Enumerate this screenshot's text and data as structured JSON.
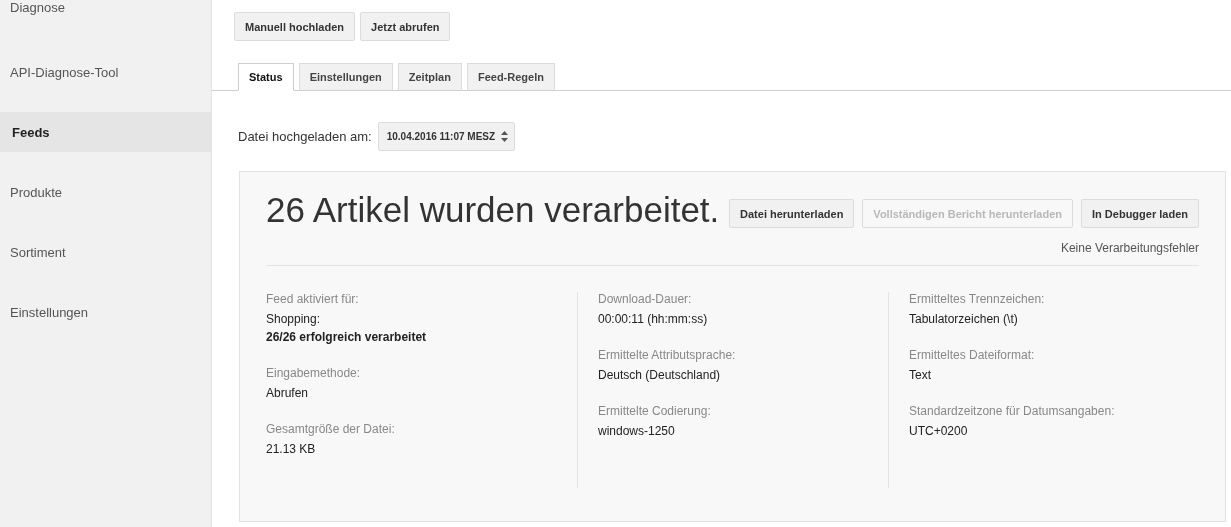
{
  "sidebar": {
    "items": [
      {
        "label": "Diagnose",
        "selected": false
      },
      {
        "label": "API-Diagnose-Tool",
        "selected": false
      },
      {
        "label": "Feeds",
        "selected": true
      },
      {
        "label": "Produkte",
        "selected": false
      },
      {
        "label": "Sortiment",
        "selected": false
      },
      {
        "label": "Einstellungen",
        "selected": false
      }
    ]
  },
  "actions": [
    "Manuell hochladen",
    "Jetzt abrufen"
  ],
  "tabs": [
    {
      "label": "Status",
      "selected": true
    },
    {
      "label": "Einstellungen",
      "selected": false
    },
    {
      "label": "Zeitplan",
      "selected": false
    },
    {
      "label": "Feed-Regeln",
      "selected": false
    }
  ],
  "upload": {
    "label": "Datei hochgeladen am:",
    "value": "10.04.2016 11:07 MESZ"
  },
  "summary": {
    "title": "26 Artikel wurden verarbeitet.",
    "buttons": [
      {
        "label": "Datei herunterladen",
        "disabled": false
      },
      {
        "label": "Vollständigen Bericht herunterladen",
        "disabled": true
      },
      {
        "label": "In Debugger laden",
        "disabled": false
      }
    ],
    "note": "Keine Verarbeitungsfehler"
  },
  "columns": [
    [
      {
        "label": "Feed aktiviert für:",
        "lines": [
          {
            "text": "Shopping:",
            "bold": false
          },
          {
            "text": "26/26 erfolgreich verarbeitet",
            "bold": true
          }
        ]
      },
      {
        "label": "Eingabemethode:",
        "lines": [
          {
            "text": "Abrufen",
            "bold": false
          }
        ]
      },
      {
        "label": "Gesamtgröße der Datei:",
        "lines": [
          {
            "text": "21.13 KB",
            "bold": false
          }
        ]
      }
    ],
    [
      {
        "label": "Download-Dauer:",
        "lines": [
          {
            "text": "00:00:11 (hh:mm:ss)",
            "bold": false
          }
        ]
      },
      {
        "label": "Ermittelte Attributsprache:",
        "lines": [
          {
            "text": "Deutsch (Deutschland)",
            "bold": false
          }
        ]
      },
      {
        "label": "Ermittelte Codierung:",
        "lines": [
          {
            "text": "windows-1250",
            "bold": false
          }
        ]
      }
    ],
    [
      {
        "label": "Ermitteltes Trennzeichen:",
        "lines": [
          {
            "text": "Tabulatorzeichen (\\t)",
            "bold": false
          }
        ]
      },
      {
        "label": "Ermitteltes Dateiformat:",
        "lines": [
          {
            "text": "Text",
            "bold": false
          }
        ]
      },
      {
        "label": "Standardzeitzone für Datumsangaben:",
        "lines": [
          {
            "text": "UTC+0200",
            "bold": false
          }
        ]
      }
    ]
  ]
}
